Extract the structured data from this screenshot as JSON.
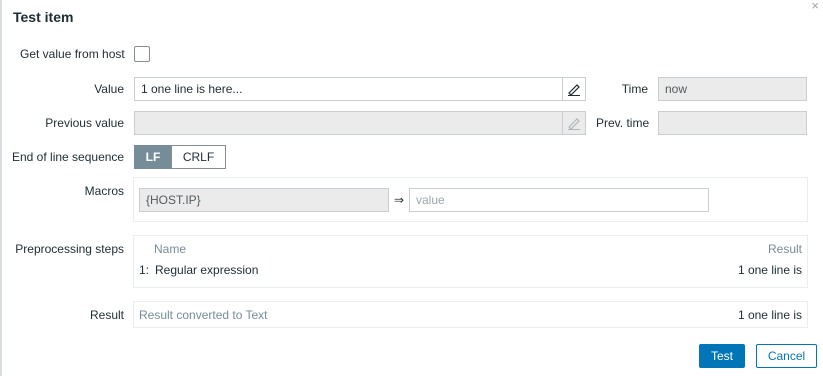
{
  "dialog": {
    "title": "Test item",
    "close_glyph": "×"
  },
  "get_value": {
    "label": "Get value from host",
    "checked": false
  },
  "value": {
    "label": "Value",
    "text": "1 one line is here..."
  },
  "time": {
    "label": "Time",
    "value": "now"
  },
  "previous_value": {
    "label": "Previous value",
    "text": ""
  },
  "prev_time": {
    "label": "Prev. time",
    "value": ""
  },
  "eol": {
    "label": "End of line sequence",
    "options": [
      "LF",
      "CRLF"
    ],
    "selected": "LF"
  },
  "macros": {
    "label": "Macros",
    "name": "{HOST.IP}",
    "arrow": "⇒",
    "value_placeholder": "value"
  },
  "preprocessing": {
    "label": "Preprocessing steps",
    "col_name": "Name",
    "col_result": "Result",
    "steps": [
      {
        "index": "1:",
        "name": "Regular expression",
        "result": "1 one line is"
      }
    ]
  },
  "result": {
    "label": "Result",
    "converted": "Result converted to Text",
    "value": "1 one line is"
  },
  "buttons": {
    "test": "Test",
    "cancel": "Cancel"
  }
}
